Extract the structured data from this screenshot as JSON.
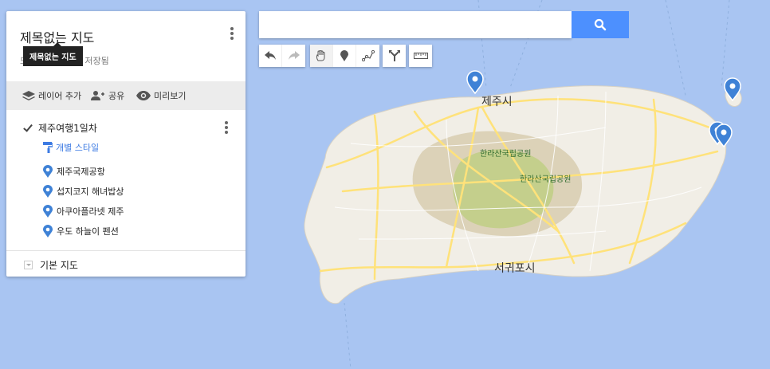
{
  "map": {
    "title": "제목없는 지도",
    "save_status": "모든 변경 내용이 저장됨",
    "tooltip": "제목없는 지도",
    "labels": {
      "jeju_city": "제주시",
      "hallasan_1": "한라산국립공원",
      "hallasan_2": "한라산국립공원",
      "seogwipo": "서귀포시"
    }
  },
  "actions": {
    "add_layer": "레이어 추가",
    "share": "공유",
    "preview": "미리보기"
  },
  "layer": {
    "name": "제주여행1일차",
    "style_link": "개별 스타일",
    "places": [
      "제주국제공항",
      "섭지코지 해녀밥상",
      "아쿠아플라넷 제주",
      "우도 하늘이 펜션"
    ]
  },
  "base_map": {
    "label": "기본 지도"
  },
  "search": {
    "placeholder": ""
  },
  "colors": {
    "water": "#a9c5f2",
    "land": "#f1eee6",
    "park": "#c4cf8c",
    "road": "#ffe27a",
    "pin": "#3f82d6",
    "accent": "#4d90fe"
  }
}
